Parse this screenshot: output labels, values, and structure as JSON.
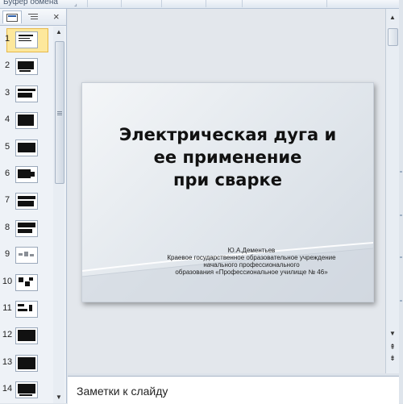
{
  "ribbon": {
    "group_label": "Буфер обмена",
    "launcher_icon": "dialog-launcher-icon"
  },
  "panel": {
    "tabs": [
      {
        "name": "slides-tab",
        "icon": "slides-icon"
      },
      {
        "name": "outline-tab",
        "icon": "outline-icon"
      }
    ],
    "close_glyph": "×",
    "thumbnails": [
      {
        "number": "1",
        "selected": true
      },
      {
        "number": "2"
      },
      {
        "number": "3"
      },
      {
        "number": "4"
      },
      {
        "number": "5"
      },
      {
        "number": "6"
      },
      {
        "number": "7"
      },
      {
        "number": "8"
      },
      {
        "number": "9"
      },
      {
        "number": "10"
      },
      {
        "number": "11"
      },
      {
        "number": "12"
      },
      {
        "number": "13"
      },
      {
        "number": "14"
      }
    ]
  },
  "slide": {
    "title": "Электрическая дуга и\nее применение\nпри сварке",
    "author": "Ю.А.Дементьев",
    "org_line1": "Краевое государственное образовательное учреждение",
    "org_line2": "начального профессионального",
    "org_line3": "образования «Профессиональное училище № 46»"
  },
  "scroll": {
    "up_glyph": "▲",
    "down_glyph": "▼",
    "prev_slide_glyph": "⇞",
    "next_slide_glyph": "⇟"
  },
  "notes": {
    "placeholder": "Заметки к слайду"
  },
  "colors": {
    "selected_thumb": "#fde89c",
    "slide_bg": "#e4e9ee",
    "panel_bg": "#eef2f7"
  }
}
